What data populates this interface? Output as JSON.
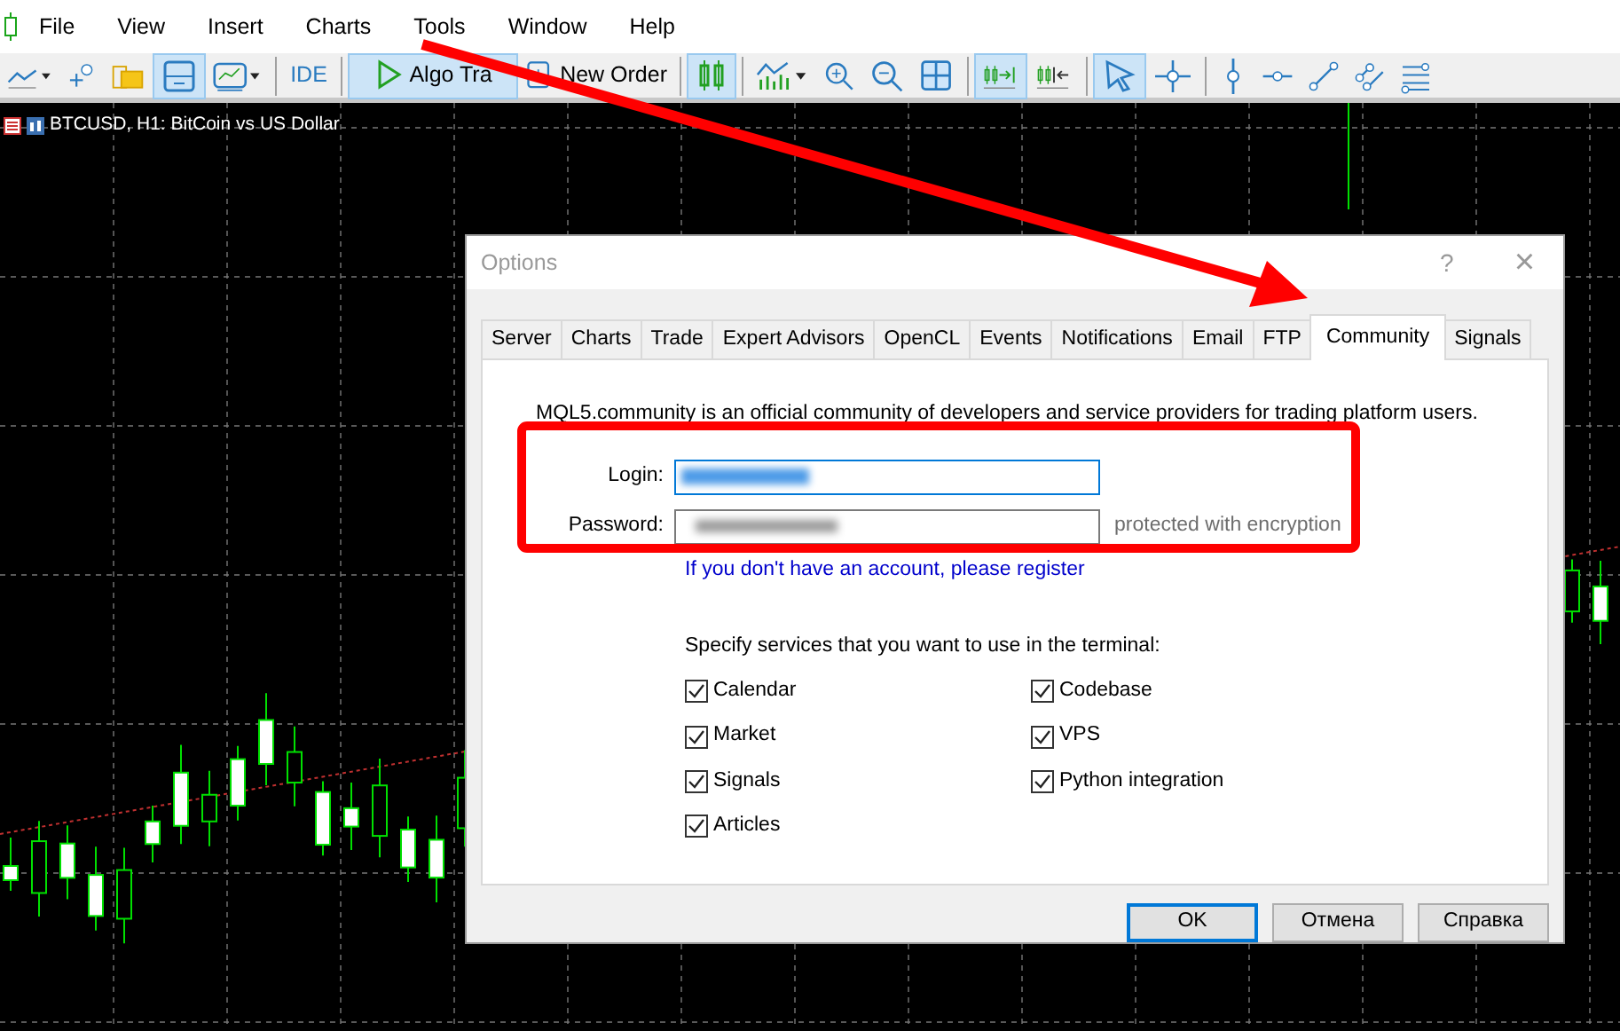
{
  "menu": [
    "File",
    "View",
    "Insert",
    "Charts",
    "Tools",
    "Window",
    "Help"
  ],
  "toolbar": [
    {
      "selected": false
    },
    {
      "selected": false
    },
    {
      "selected": false
    },
    {
      "selected": true
    },
    {
      "selected": false
    },
    {
      "label": "IDE",
      "selected": false
    },
    {
      "label": "Algo Tra",
      "selected": true
    },
    {
      "label": "New Order",
      "selected": false
    },
    {
      "selected": true
    },
    {
      "selected": false
    },
    {
      "selected": false
    },
    {
      "selected": false
    },
    {
      "selected": false
    },
    {
      "selected": true
    },
    {
      "selected": false
    },
    {
      "selected": true
    },
    {
      "selected": false
    },
    {
      "selected": false
    },
    {
      "selected": false
    },
    {
      "selected": false
    },
    {
      "selected": false
    },
    {
      "selected": false
    }
  ],
  "chart": {
    "title": "BTCUSD, H1: BitCoin vs US Dollar"
  },
  "dialog": {
    "title": "Options",
    "help": "?",
    "close": "×",
    "tabs": [
      {
        "label": "Server",
        "selected": false
      },
      {
        "label": "Charts",
        "selected": false
      },
      {
        "label": "Trade",
        "selected": false
      },
      {
        "label": "Expert Advisors",
        "selected": false
      },
      {
        "label": "OpenCL",
        "selected": false
      },
      {
        "label": "Events",
        "selected": false
      },
      {
        "label": "Notifications",
        "selected": false
      },
      {
        "label": "Email",
        "selected": false
      },
      {
        "label": "FTP",
        "selected": false
      },
      {
        "label": "Community",
        "selected": true
      },
      {
        "label": "Signals",
        "selected": false
      }
    ],
    "intro": "MQL5.community is an official community of developers and service providers for trading platform users.",
    "login_label": "Login:",
    "password_label": "Password:",
    "password_note": "protected with encryption",
    "register_link": "If you don't have an account, please register",
    "services_label": "Specify services that you want to use in the terminal:",
    "services": [
      {
        "label": "Calendar",
        "checked": true
      },
      {
        "label": "Codebase",
        "checked": true
      },
      {
        "label": "Market",
        "checked": true
      },
      {
        "label": "VPS",
        "checked": true
      },
      {
        "label": "Signals",
        "checked": true
      },
      {
        "label": "Python integration",
        "checked": true
      },
      {
        "label": "Articles",
        "checked": true
      }
    ],
    "buttons": [
      {
        "label": "OK",
        "default": true
      },
      {
        "label": "Отмена",
        "default": false
      },
      {
        "label": "Справка",
        "default": false
      }
    ]
  }
}
